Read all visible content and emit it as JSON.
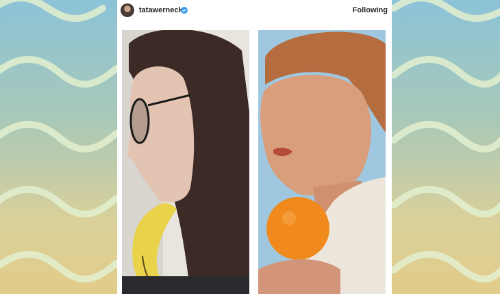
{
  "post": {
    "username": "tatawerneck",
    "verified": true,
    "follow_label": "Following"
  },
  "photos": [
    {
      "subject": "woman-with-glasses-holding-banana-under-chin"
    },
    {
      "subject": "woman-holding-orange-under-chin"
    }
  ],
  "colors": {
    "background_top": "#8cc3d8",
    "background_bottom": "#e2cc8a",
    "wave": "#d7ecd2",
    "card": "#ffffff",
    "verified_badge": "#3897f0",
    "text": "#262626"
  }
}
